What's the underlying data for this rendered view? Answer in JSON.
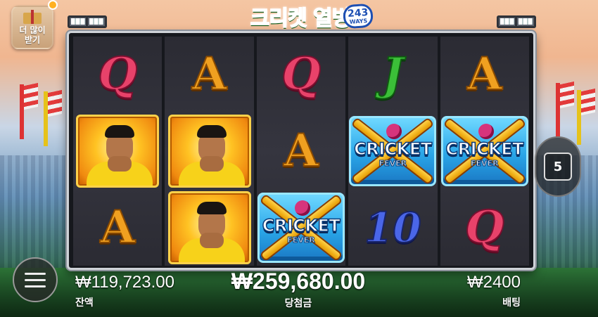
{
  "game": {
    "title": "크리켓 열병",
    "ways_number": "243",
    "ways_label": "WAYS"
  },
  "top_left": {
    "gift_label": "더 많이 받기"
  },
  "reels": [
    [
      "Q",
      "player",
      "A"
    ],
    [
      "A",
      "player",
      "player"
    ],
    [
      "Q",
      "A",
      "cricket-fever"
    ],
    [
      "J",
      "cricket-fever",
      "10"
    ],
    [
      "A",
      "cricket-fever",
      "Q"
    ]
  ],
  "symbols": {
    "cricket_fever_main": "CRICKET",
    "cricket_fever_sub": "FEVER"
  },
  "auto_spin": {
    "count": "5"
  },
  "bottom": {
    "balance_value": "₩119,723.00",
    "balance_label": "잔액",
    "win_value": "₩259,680.00",
    "win_label": "당첨금",
    "bet_value": "₩2400",
    "bet_label": "배팅"
  },
  "colors": {
    "q": "#e8426a",
    "a": "#f0a020",
    "j": "#3bbf38",
    "ten": "#4a66e8",
    "cricket_tile": "#2aa6e8"
  }
}
